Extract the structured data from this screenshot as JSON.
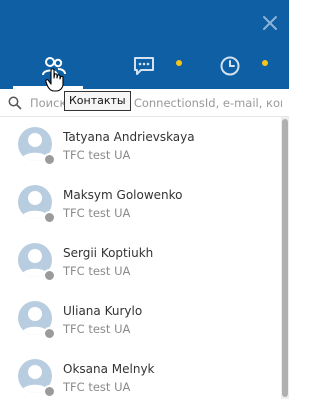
{
  "header": {
    "bg_color": "#0e5fa3",
    "accent_dot_color": "#f5c518"
  },
  "tabs": [
    {
      "id": "contacts",
      "icon": "contacts-icon",
      "active": true,
      "tooltip": "Контакты"
    },
    {
      "id": "chat",
      "icon": "chat-bubble-icon",
      "active": false,
      "has_indicator": true
    },
    {
      "id": "history",
      "icon": "clock-icon",
      "active": false,
      "has_indicator": true
    }
  ],
  "close_icon": "close-icon",
  "search": {
    "placeholder": "Поиск по имени, ConnectionsId, e-mail, компании ..."
  },
  "contacts": [
    {
      "name": "Tatyana Andrievskaya",
      "company": "TFC test UA",
      "status": "offline"
    },
    {
      "name": "Maksym Golowenko",
      "company": "TFC test UA",
      "status": "offline"
    },
    {
      "name": "Sergii Koptiukh",
      "company": "TFC test UA",
      "status": "offline"
    },
    {
      "name": "Uliana Kurylo",
      "company": "TFC test UA",
      "status": "offline"
    },
    {
      "name": "Oksana Melnyk",
      "company": "TFC test UA",
      "status": "offline"
    }
  ]
}
